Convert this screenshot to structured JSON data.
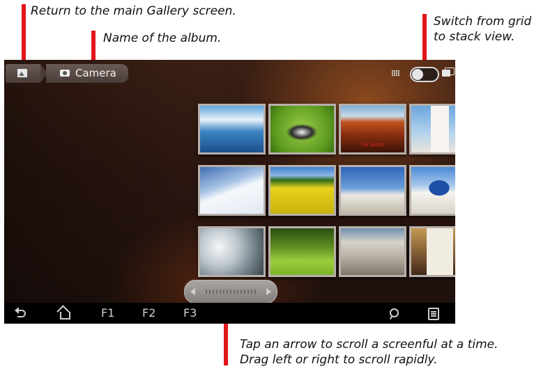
{
  "callouts": {
    "gallery": "Return to the main Gallery screen.",
    "album_name": "Name of the album.",
    "switch_line1": "Switch from grid",
    "switch_line2": "to stack view.",
    "scroll_line1": "Tap an arrow to scroll a screenful at a time.",
    "scroll_line2": "Drag left or right to scroll rapidly."
  },
  "colors": {
    "pointer": "#e0161b"
  },
  "header": {
    "gallery_icon": "gallery-icon",
    "album_icon": "camera-icon",
    "album_name": "Camera",
    "view_switch": {
      "grid_icon": "grid-icon",
      "stack_icon": "stack-icon",
      "mode": "grid"
    }
  },
  "thumbnails": [
    {
      "subject": "lake-mountains",
      "caption": ""
    },
    {
      "subject": "green-field-cow",
      "caption": ""
    },
    {
      "subject": "red-desert-mesa",
      "caption": "THE WINDS"
    },
    {
      "subject": "church-bell-tower",
      "caption": ""
    },
    {
      "subject": "snow-slope",
      "caption": ""
    },
    {
      "subject": "yellow-flower-field",
      "caption": ""
    },
    {
      "subject": "windmill",
      "caption": ""
    },
    {
      "subject": "blue-dome-church",
      "caption": ""
    },
    {
      "subject": "frosted-trees",
      "caption": ""
    },
    {
      "subject": "forest-lawn",
      "caption": ""
    },
    {
      "subject": "hillside-town",
      "caption": ""
    },
    {
      "subject": "white-chapel",
      "caption": ""
    }
  ],
  "scroller": {
    "left_icon": "left-arrow-icon",
    "right_icon": "right-arrow-icon"
  },
  "system_bar": {
    "back_icon": "back-icon",
    "home_icon": "home-icon",
    "f1": "F1",
    "f2": "F2",
    "f3": "F3",
    "search_icon": "search-icon",
    "menu_icon": "menu-icon"
  }
}
